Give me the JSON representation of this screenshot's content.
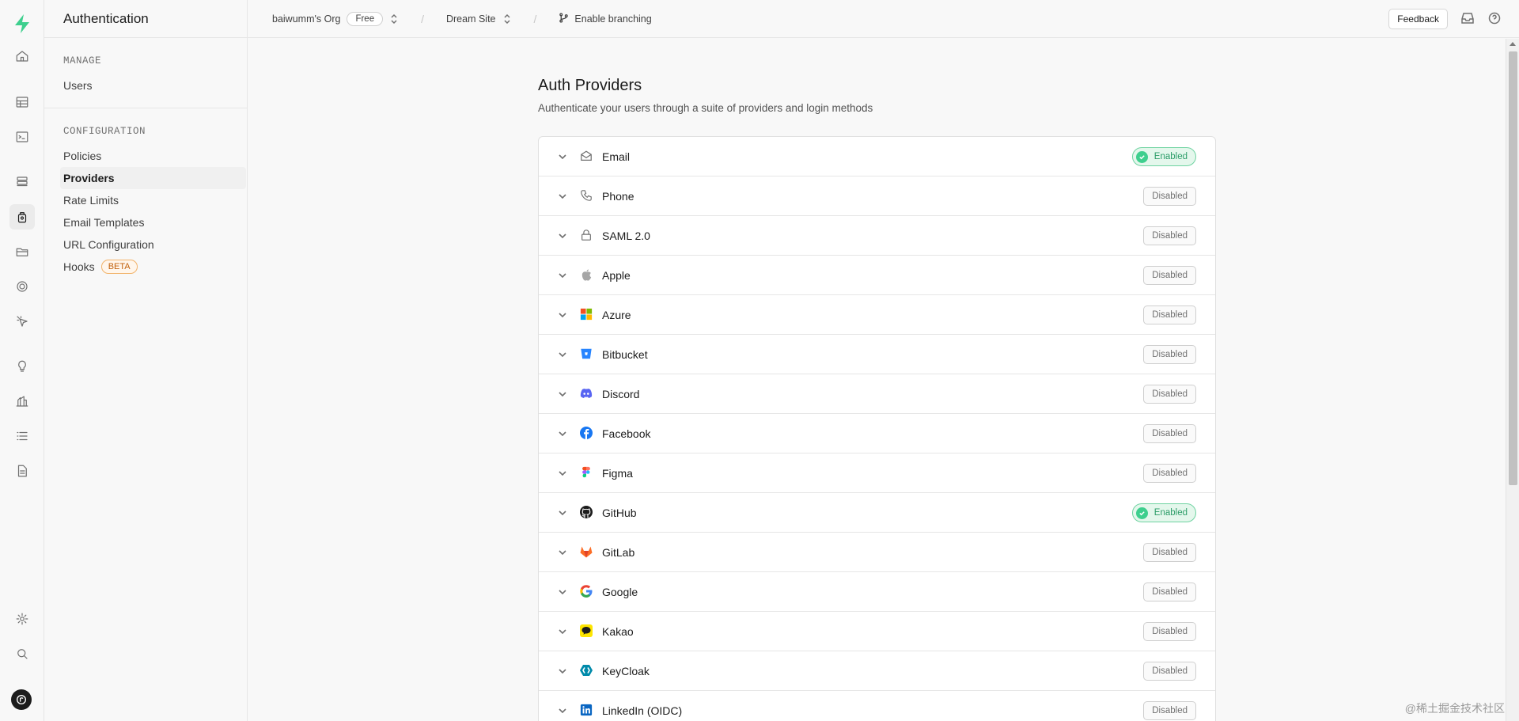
{
  "section_title": "Authentication",
  "sidebar": {
    "manage_heading": "MANAGE",
    "manage_items": [
      {
        "label": "Users"
      }
    ],
    "config_heading": "CONFIGURATION",
    "config_items": [
      {
        "label": "Policies"
      },
      {
        "label": "Providers"
      },
      {
        "label": "Rate Limits"
      },
      {
        "label": "Email Templates"
      },
      {
        "label": "URL Configuration"
      },
      {
        "label": "Hooks"
      }
    ],
    "hooks_badge": "BETA"
  },
  "topbar": {
    "org": "baiwumm's Org",
    "plan": "Free",
    "project": "Dream Site",
    "branching": "Enable branching",
    "feedback": "Feedback"
  },
  "page": {
    "title": "Auth Providers",
    "subtitle": "Authenticate your users through a suite of providers and login methods"
  },
  "providers": [
    {
      "name": "Email",
      "status": "Enabled",
      "icon": "email-icon"
    },
    {
      "name": "Phone",
      "status": "Disabled",
      "icon": "phone-icon"
    },
    {
      "name": "SAML 2.0",
      "status": "Disabled",
      "icon": "lock-icon"
    },
    {
      "name": "Apple",
      "status": "Disabled",
      "icon": "apple-icon"
    },
    {
      "name": "Azure",
      "status": "Disabled",
      "icon": "azure-icon"
    },
    {
      "name": "Bitbucket",
      "status": "Disabled",
      "icon": "bitbucket-icon"
    },
    {
      "name": "Discord",
      "status": "Disabled",
      "icon": "discord-icon"
    },
    {
      "name": "Facebook",
      "status": "Disabled",
      "icon": "facebook-icon"
    },
    {
      "name": "Figma",
      "status": "Disabled",
      "icon": "figma-icon"
    },
    {
      "name": "GitHub",
      "status": "Enabled",
      "icon": "github-icon"
    },
    {
      "name": "GitLab",
      "status": "Disabled",
      "icon": "gitlab-icon"
    },
    {
      "name": "Google",
      "status": "Disabled",
      "icon": "google-icon"
    },
    {
      "name": "Kakao",
      "status": "Disabled",
      "icon": "kakao-icon"
    },
    {
      "name": "KeyCloak",
      "status": "Disabled",
      "icon": "keycloak-icon"
    },
    {
      "name": "LinkedIn (OIDC)",
      "status": "Disabled",
      "icon": "linkedin-icon"
    }
  ],
  "watermark": "@稀土掘金技术社区",
  "colors": {
    "brand": "#3ecf8e",
    "enabled_text": "#2a9c67",
    "beta": "#c2610c"
  }
}
